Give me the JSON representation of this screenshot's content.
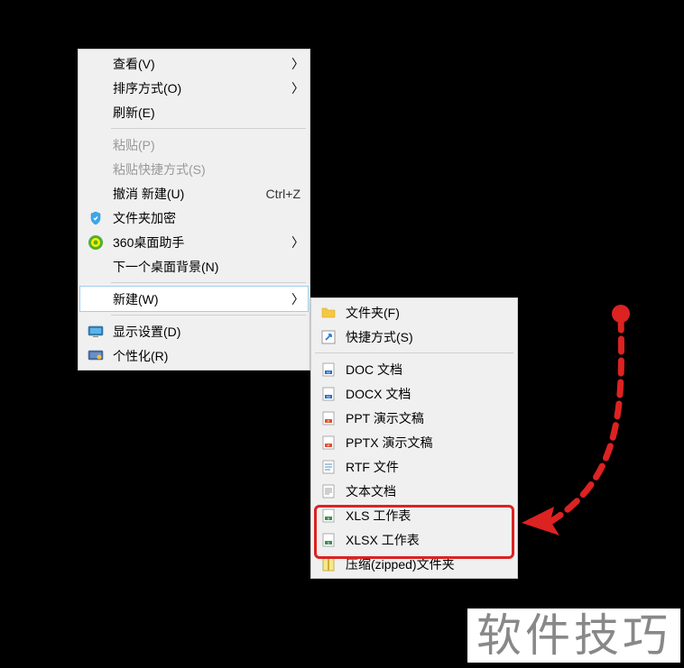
{
  "main_menu": {
    "group1": [
      {
        "label": "查看(V)",
        "arrow": true
      },
      {
        "label": "排序方式(O)",
        "arrow": true
      },
      {
        "label": "刷新(E)"
      }
    ],
    "group2": [
      {
        "label": "粘贴(P)",
        "disabled": true
      },
      {
        "label": "粘贴快捷方式(S)",
        "disabled": true
      },
      {
        "label": "撤消 新建(U)",
        "shortcut": "Ctrl+Z"
      },
      {
        "label": "文件夹加密",
        "icon": "shield"
      },
      {
        "label": "360桌面助手",
        "icon": "360",
        "arrow": true
      },
      {
        "label": "下一个桌面背景(N)"
      }
    ],
    "new_item": {
      "label": "新建(W)",
      "arrow": true,
      "hovered": true
    },
    "group3": [
      {
        "label": "显示设置(D)",
        "icon": "monitor"
      },
      {
        "label": "个性化(R)",
        "icon": "personalize"
      }
    ]
  },
  "sub_menu": {
    "group1": [
      {
        "label": "文件夹(F)",
        "icon": "folder"
      },
      {
        "label": "快捷方式(S)",
        "icon": "shortcut"
      }
    ],
    "group2": [
      {
        "label": "DOC 文档",
        "icon": "doc"
      },
      {
        "label": "DOCX 文档",
        "icon": "docx"
      },
      {
        "label": "PPT 演示文稿",
        "icon": "ppt"
      },
      {
        "label": "PPTX 演示文稿",
        "icon": "pptx"
      },
      {
        "label": "RTF 文件",
        "icon": "rtf"
      },
      {
        "label": "文本文档",
        "icon": "txt"
      },
      {
        "label": "XLS 工作表",
        "icon": "xls"
      },
      {
        "label": "XLSX 工作表",
        "icon": "xlsx"
      },
      {
        "label": "压缩(zipped)文件夹",
        "icon": "zip"
      }
    ]
  },
  "watermark": "软件技巧"
}
